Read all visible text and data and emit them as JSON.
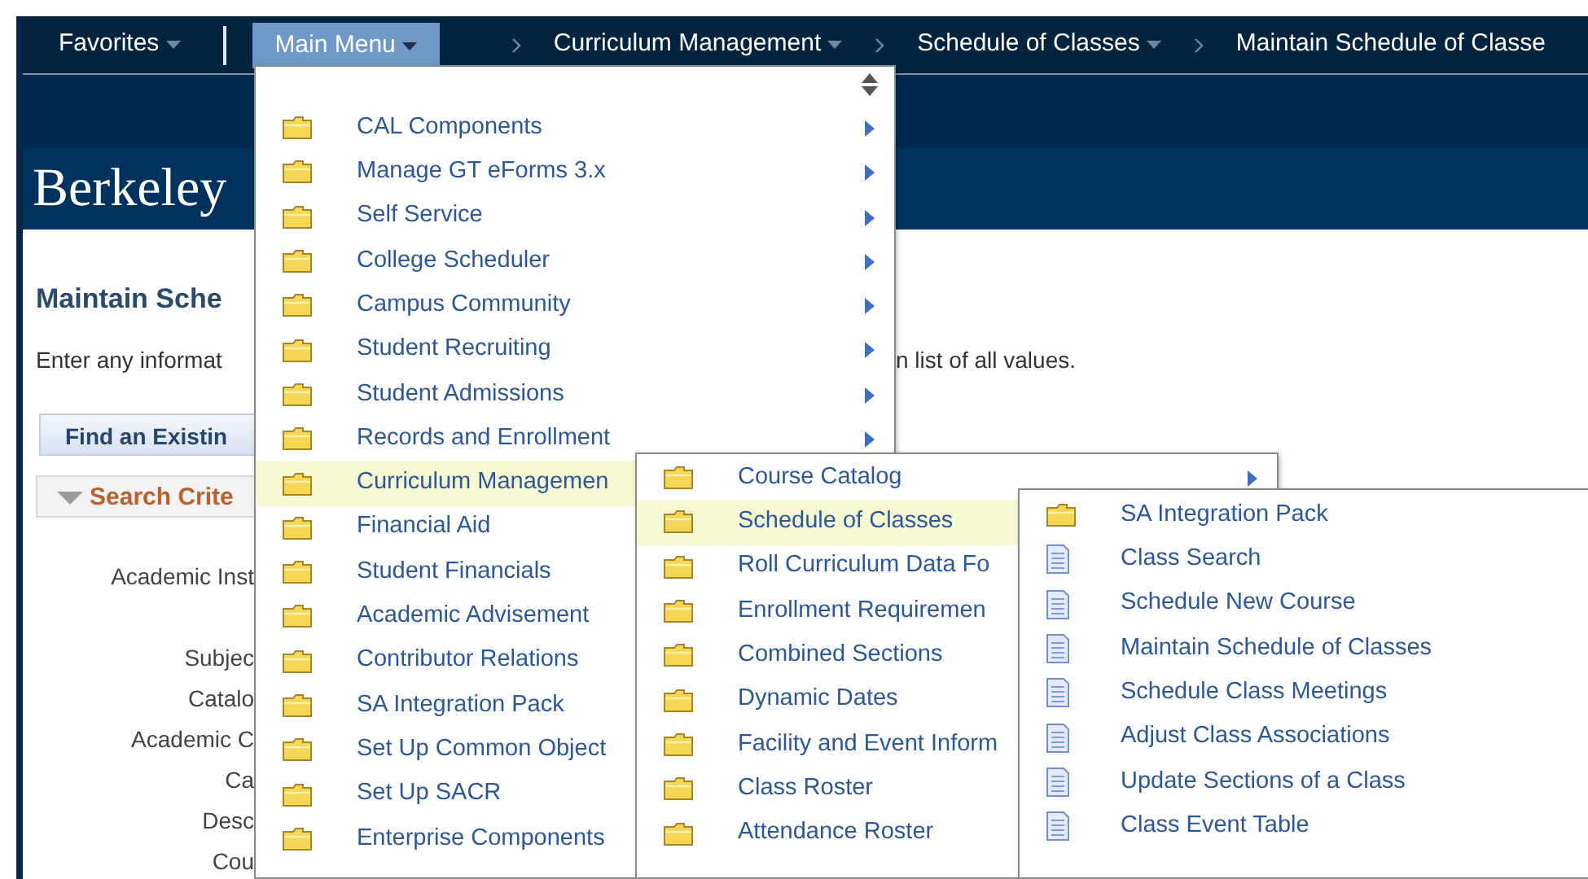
{
  "nav": {
    "items": [
      {
        "label": "Favorites",
        "kind": "dropdown",
        "selected": false
      },
      {
        "label": "Main Menu",
        "kind": "dropdown",
        "selected": true
      },
      {
        "label": "Curriculum Management",
        "kind": "crumb",
        "selected": false
      },
      {
        "label": "Schedule of Classes",
        "kind": "crumb",
        "selected": false
      },
      {
        "label": "Maintain Schedule of Classe",
        "kind": "crumb-end",
        "selected": false
      }
    ]
  },
  "banner": {
    "logo": "Berkeley"
  },
  "page": {
    "title": "Maintain Sche",
    "instructions": [
      "Enter any informat",
      "n list of all values."
    ],
    "tab": "Find an Existin",
    "section": "Search Crite",
    "field_labels": [
      "Academic Inst",
      "Subjec",
      "Catalo",
      "Academic C",
      "Ca",
      "Desc",
      "Cou"
    ]
  },
  "menus": [
    {
      "kind": "main",
      "items": [
        {
          "label": "CAL Components",
          "kind": "folder",
          "has_submenu": true,
          "selected": false
        },
        {
          "label": "Manage GT eForms 3.x",
          "kind": "folder",
          "has_submenu": true,
          "selected": false
        },
        {
          "label": "Self Service",
          "kind": "folder",
          "has_submenu": true,
          "selected": false
        },
        {
          "label": "College Scheduler",
          "kind": "folder",
          "has_submenu": true,
          "selected": false
        },
        {
          "label": "Campus Community",
          "kind": "folder",
          "has_submenu": true,
          "selected": false
        },
        {
          "label": "Student Recruiting",
          "kind": "folder",
          "has_submenu": true,
          "selected": false
        },
        {
          "label": "Student Admissions",
          "kind": "folder",
          "has_submenu": true,
          "selected": false
        },
        {
          "label": "Records and Enrollment",
          "kind": "folder",
          "has_submenu": true,
          "selected": false
        },
        {
          "label": "Curriculum Managemen",
          "kind": "folder",
          "has_submenu": false,
          "selected": true
        },
        {
          "label": "Financial Aid",
          "kind": "folder",
          "has_submenu": false,
          "selected": false
        },
        {
          "label": "Student Financials",
          "kind": "folder",
          "has_submenu": false,
          "selected": false
        },
        {
          "label": "Academic Advisement",
          "kind": "folder",
          "has_submenu": false,
          "selected": false
        },
        {
          "label": "Contributor Relations",
          "kind": "folder",
          "has_submenu": false,
          "selected": false
        },
        {
          "label": "SA Integration Pack",
          "kind": "folder",
          "has_submenu": false,
          "selected": false
        },
        {
          "label": "Set Up Common Object",
          "kind": "folder",
          "has_submenu": false,
          "selected": false
        },
        {
          "label": "Set Up SACR",
          "kind": "folder",
          "has_submenu": false,
          "selected": false
        },
        {
          "label": "Enterprise Components",
          "kind": "folder",
          "has_submenu": false,
          "selected": false
        }
      ]
    },
    {
      "kind": "submenu",
      "items": [
        {
          "label": "Course Catalog",
          "kind": "folder",
          "has_submenu": true,
          "selected": false
        },
        {
          "label": "Schedule of Classes",
          "kind": "folder",
          "has_submenu": false,
          "selected": true
        },
        {
          "label": "Roll Curriculum Data Fo",
          "kind": "folder",
          "has_submenu": false,
          "selected": false
        },
        {
          "label": "Enrollment Requiremen",
          "kind": "folder",
          "has_submenu": false,
          "selected": false
        },
        {
          "label": "Combined Sections",
          "kind": "folder",
          "has_submenu": false,
          "selected": false
        },
        {
          "label": "Dynamic Dates",
          "kind": "folder",
          "has_submenu": false,
          "selected": false
        },
        {
          "label": "Facility and Event Inform",
          "kind": "folder",
          "has_submenu": false,
          "selected": false
        },
        {
          "label": "Class Roster",
          "kind": "folder",
          "has_submenu": false,
          "selected": false
        },
        {
          "label": "Attendance Roster",
          "kind": "folder",
          "has_submenu": false,
          "selected": false
        }
      ]
    },
    {
      "kind": "submenu",
      "items": [
        {
          "label": "SA Integration Pack",
          "kind": "folder",
          "has_submenu": false,
          "selected": false
        },
        {
          "label": "Class Search",
          "kind": "page",
          "has_submenu": false,
          "selected": false
        },
        {
          "label": "Schedule New Course",
          "kind": "page",
          "has_submenu": false,
          "selected": false
        },
        {
          "label": "Maintain Schedule of Classes",
          "kind": "page",
          "has_submenu": false,
          "selected": false
        },
        {
          "label": "Schedule Class Meetings",
          "kind": "page",
          "has_submenu": false,
          "selected": false
        },
        {
          "label": "Adjust Class Associations",
          "kind": "page",
          "has_submenu": false,
          "selected": false
        },
        {
          "label": "Update Sections of a Class",
          "kind": "page",
          "has_submenu": false,
          "selected": false
        },
        {
          "label": "Class Event Table",
          "kind": "page",
          "has_submenu": false,
          "selected": false
        }
      ]
    }
  ]
}
